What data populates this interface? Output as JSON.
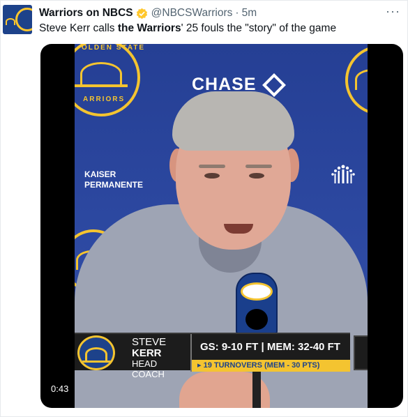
{
  "tweet": {
    "display_name": "Warriors on NBCS",
    "handle": "@NBCSWarriors",
    "separator": "·",
    "time": "5m",
    "more": "···",
    "text_before": "Steve Kerr calls ",
    "text_bold": "the Warriors",
    "text_after": "' 25 fouls the \"story\" of the game"
  },
  "video": {
    "duration": "0:43",
    "sponsor_top": "CHASE",
    "sponsor_left_line1": "KAISER",
    "sponsor_left_line2": "PERMANENTE",
    "logo_text_top": "OLDEN STATE",
    "logo_text_bottom": "ARRIORS",
    "lower_third": {
      "first_name": "STEVE",
      "last_name": "KERR",
      "title": "HEAD COACH",
      "stats": "GS: 9-10 FT | MEM: 32-40 FT",
      "sub_stat": "▸ 19 TURNOVERS (MEM - 30 PTS)"
    }
  },
  "colors": {
    "verified": "#ffc72c",
    "warriors_blue": "#1d428a",
    "warriors_gold": "#f4c430"
  }
}
